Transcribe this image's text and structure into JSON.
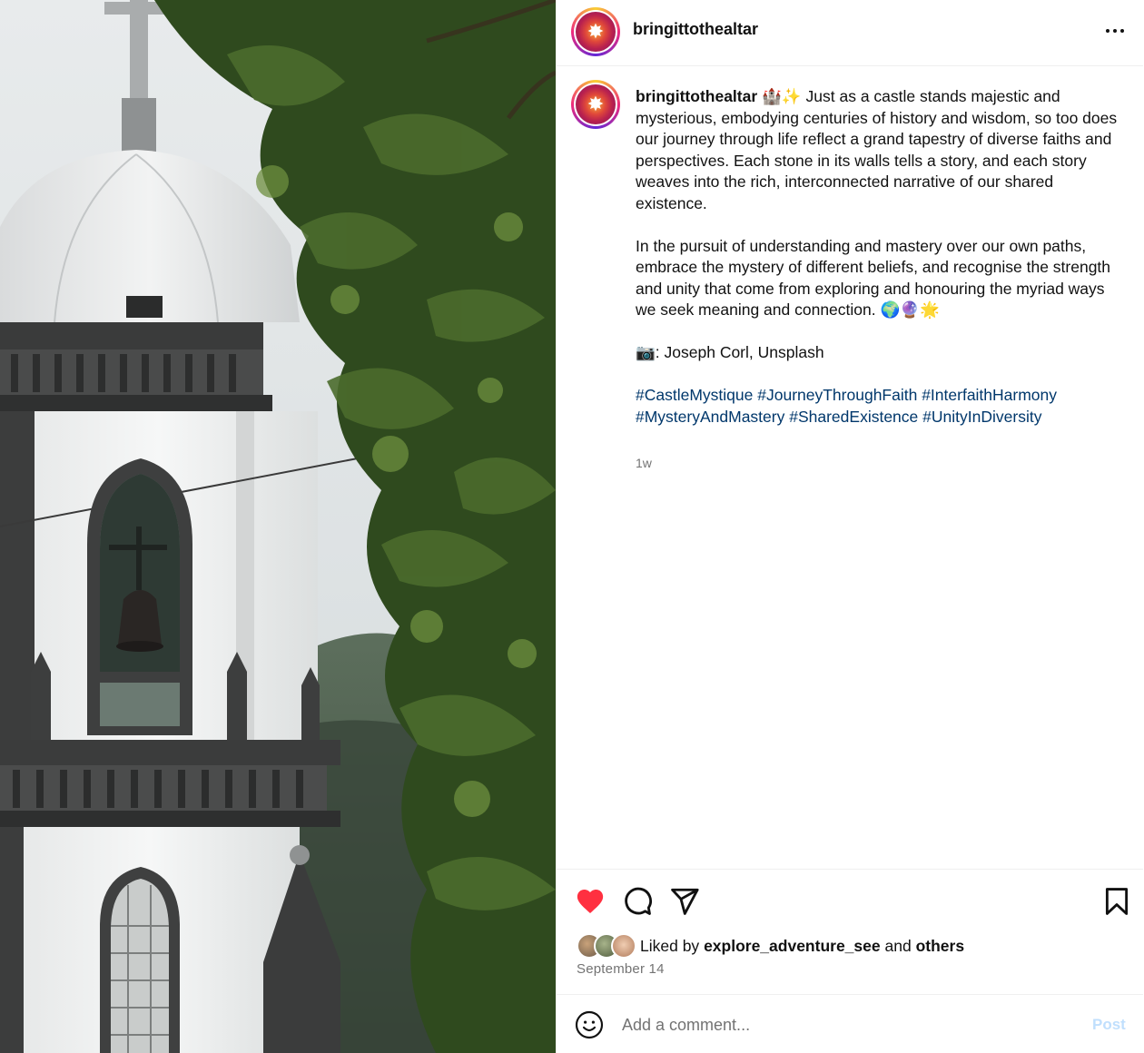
{
  "post": {
    "username": "bringittothealtar",
    "image_alt": "",
    "caption": {
      "username": "bringittothealtar",
      "intro_emoji": "🏰✨",
      "paragraph1": "Just as a castle stands majestic and mysterious, embodying centuries of history and wisdom, so too does our journey through life reflect a grand tapestry of diverse faiths and perspectives. Each stone in its walls tells a story, and each story weaves into the rich, interconnected narrative of our shared existence.",
      "paragraph2": "In the pursuit of understanding and mastery over our own paths, embrace the mystery of different beliefs, and recognise the strength and unity that come from exploring and honouring the myriad ways we seek meaning and connection.",
      "paragraph2_emoji": "🌍🔮🌟",
      "credit_emoji": "📷",
      "credit": ": Joseph Corl, Unsplash",
      "hashtags": [
        "#CastleMystique",
        "#JourneyThroughFaith",
        "#InterfaithHarmony",
        "#MysteryAndMastery",
        "#SharedExistence",
        "#UnityInDiversity"
      ]
    },
    "time_ago": "1w",
    "liked": true,
    "likes": {
      "prefix": "Liked by",
      "user": "explore_adventure_see",
      "conjunction": "and",
      "others": "others"
    },
    "date": "September 14",
    "comment": {
      "placeholder": "Add a comment...",
      "post_label": "Post"
    }
  },
  "icons": {
    "more": "more-horizontal-icon",
    "like": "heart-filled-icon",
    "comment": "comment-bubble-icon",
    "share": "paper-plane-icon",
    "save": "bookmark-icon",
    "emoji": "smiley-icon"
  },
  "colors": {
    "like_red": "#ff3040",
    "hashtag_blue": "#00376b",
    "muted_gray": "#737373",
    "post_button_disabled": "#c0dffd"
  }
}
